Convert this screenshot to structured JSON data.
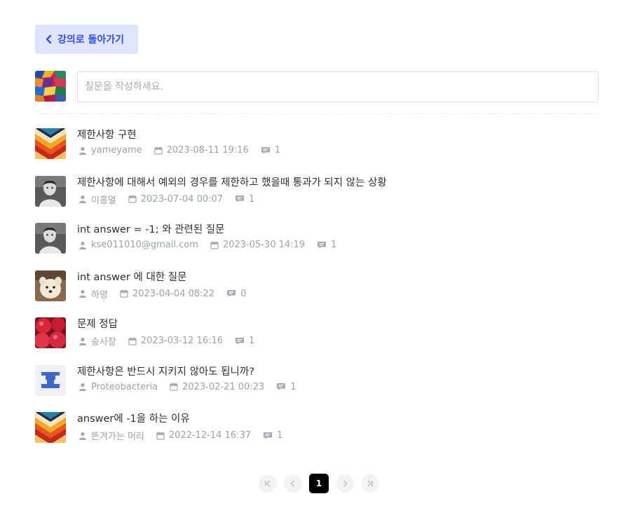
{
  "back_button": {
    "label": "강의로 돌아가기"
  },
  "composer": {
    "placeholder": "질문을 작성하세요."
  },
  "questions": [
    {
      "title": "제한사항 구현",
      "author": "yameyame",
      "datetime": "2023-08-11 19:16",
      "comments": "1",
      "avatar": "geometric-chevron"
    },
    {
      "title": "제한사항에 대해서 예외의 경우를 제한하고 했을때 통과가 되지 않는 상황",
      "author": "이홍열",
      "datetime": "2023-07-04 00:07",
      "comments": "1",
      "avatar": "bw-portrait"
    },
    {
      "title": "int answer = -1; 와 관련된 질문",
      "author": "kse011010@gmail.com",
      "datetime": "2023-05-30 14:19",
      "comments": "1",
      "avatar": "bw-portrait"
    },
    {
      "title": "int answer 에 대한 질문",
      "author": "하영",
      "datetime": "2023-04-04 08:22",
      "comments": "0",
      "avatar": "dog-photo"
    },
    {
      "title": "문제 정답",
      "author": "송사장",
      "datetime": "2023-03-12 16:16",
      "comments": "1",
      "avatar": "apples-photo"
    },
    {
      "title": "제한사항은 반드시 지키지 않아도 됩니까?",
      "author": "Proteobacteria",
      "datetime": "2023-02-21 00:23",
      "comments": "1",
      "avatar": "blue-pixel-identicon"
    },
    {
      "title": "answer에 -1을 하는 이유",
      "author": "뜬겨가는 머리",
      "datetime": "2022-12-14 16:37",
      "comments": "1",
      "avatar": "geometric-chevron"
    }
  ],
  "pagination": {
    "current_page": "1"
  },
  "colors": {
    "accent": "#2f51d8",
    "accent_bg": "#dfe3fd",
    "meta_text": "#9aa2ad",
    "active_page_bg": "#000000"
  }
}
